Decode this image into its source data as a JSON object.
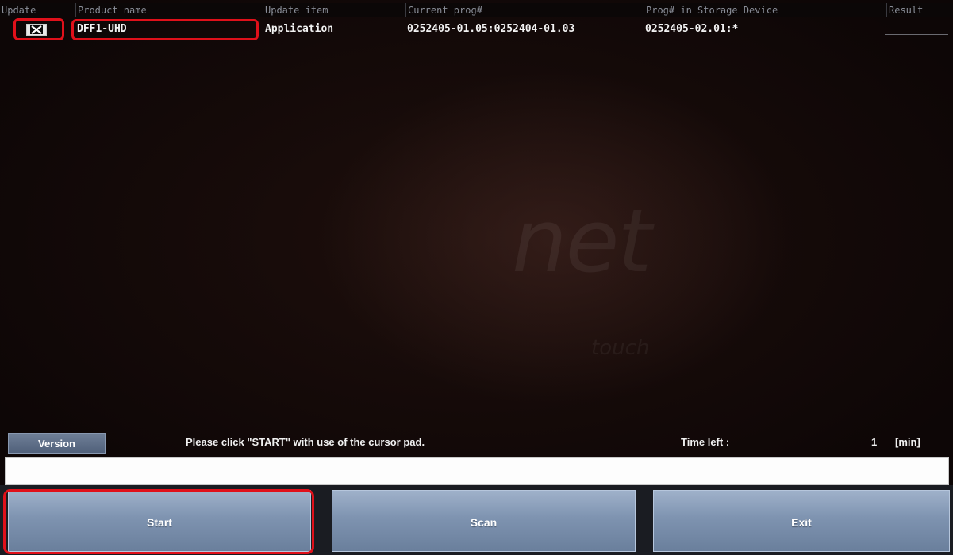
{
  "table": {
    "columns": [
      "Update",
      "Product name",
      "Update item",
      "Current prog#",
      "Prog# in Storage Device",
      "Result"
    ],
    "rows": [
      {
        "update_checked": true,
        "product_name": "DFF1-UHD",
        "update_item": "Application",
        "current_prog": "0252405-01.05:0252404-01.03",
        "storage_prog": "0252405-02.01:*",
        "result": ""
      }
    ]
  },
  "watermark": {
    "main": "net",
    "sub": "touch"
  },
  "status": {
    "version_label": "Version",
    "message": "Please click \"START\" with use of the cursor pad.",
    "time_left_label": "Time left :",
    "time_left_value": "1",
    "time_left_unit": "[min]"
  },
  "input": {
    "value": ""
  },
  "buttons": {
    "start": "Start",
    "scan": "Scan",
    "exit": "Exit"
  },
  "colors": {
    "highlight": "#e0101a",
    "button": "#7e93b0",
    "background": "#120807"
  }
}
